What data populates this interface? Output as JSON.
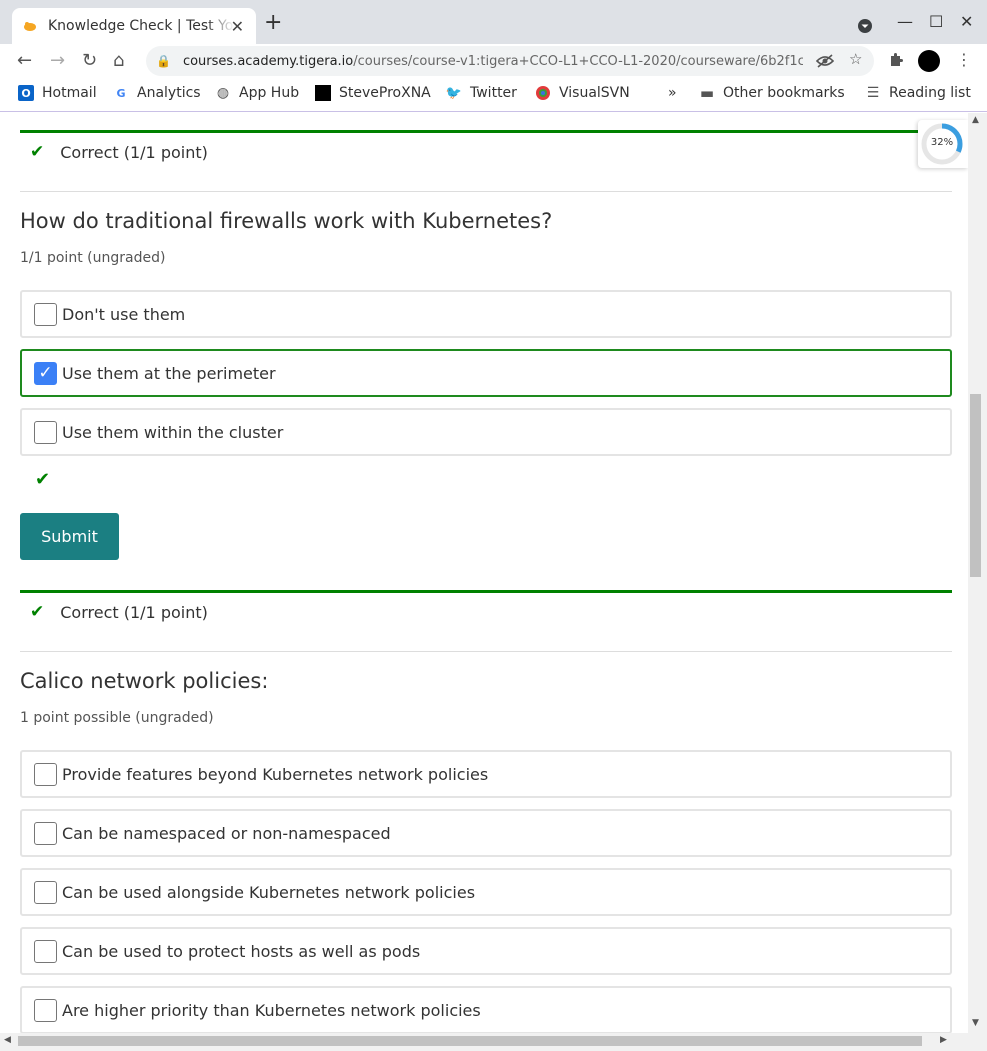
{
  "browser": {
    "tab_title": "Knowledge Check | Test Yo",
    "url_host": "courses.academy.tigera.io",
    "url_path": "/courses/course-v1:tigera+CCO-L1+CCO-L1-2020/courseware/6b2f1c92...",
    "bookmarks": [
      {
        "label": "Hotmail",
        "icon": "outlook-icon"
      },
      {
        "label": "Analytics",
        "icon": "google-icon"
      },
      {
        "label": "App Hub",
        "icon": "globe-icon"
      },
      {
        "label": "SteveProXNA",
        "icon": "steveproxna-icon"
      },
      {
        "label": "Twitter",
        "icon": "twitter-icon"
      },
      {
        "label": "VisualSVN",
        "icon": "visualsvn-icon"
      }
    ],
    "overflow": "»",
    "other_bookmarks": "Other bookmarks",
    "reading_list": "Reading list"
  },
  "page": {
    "prev_feedback": "Correct (1/1 point)",
    "q1": {
      "title": "How do traditional firewalls work with Kubernetes?",
      "points": "1/1 point (ungraded)",
      "options": [
        {
          "label": "Don't use them",
          "checked": false
        },
        {
          "label": "Use them at the perimeter",
          "checked": true
        },
        {
          "label": "Use them within the cluster",
          "checked": false
        }
      ],
      "submit_label": "Submit",
      "feedback": "Correct (1/1 point)"
    },
    "q2": {
      "title": "Calico network policies:",
      "points": "1 point possible (ungraded)",
      "options": [
        {
          "label": "Provide features beyond Kubernetes network policies",
          "checked": false
        },
        {
          "label": "Can be namespaced or non-namespaced",
          "checked": false
        },
        {
          "label": "Can be used alongside Kubernetes network policies",
          "checked": false
        },
        {
          "label": "Can be used to protect hosts as well as pods",
          "checked": false
        },
        {
          "label": "Are higher priority than Kubernetes network policies",
          "checked": false
        }
      ]
    },
    "progress": {
      "label": "32%",
      "value": 0.32,
      "color": "#3b9ee0"
    }
  },
  "colors": {
    "success": "#008100",
    "submit": "#1b7f82",
    "checkbox_checked": "#3b80f6"
  }
}
